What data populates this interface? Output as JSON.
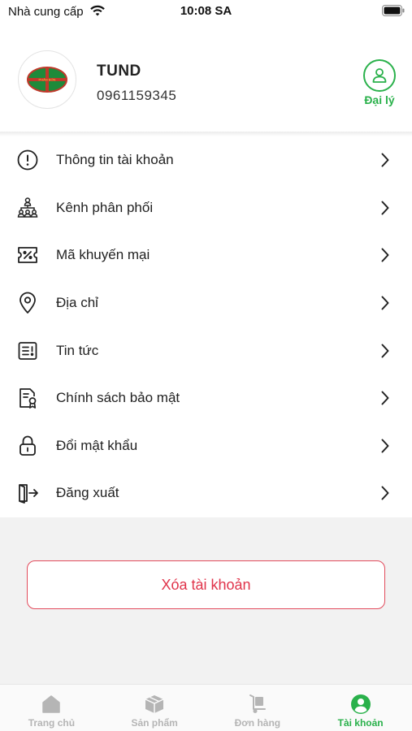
{
  "status_bar": {
    "carrier": "Nhà cung cấp",
    "time": "10:08 SA"
  },
  "profile": {
    "name": "TUND",
    "phone": "0961159345",
    "badge_label": "Đại lý",
    "logo_text": "PHÂN BÓN"
  },
  "menu": [
    {
      "label": "Thông tin tài khoản",
      "icon": "info-icon"
    },
    {
      "label": "Kênh phân phối",
      "icon": "distribution-icon"
    },
    {
      "label": "Mã khuyến mại",
      "icon": "coupon-icon"
    },
    {
      "label": "Địa chỉ",
      "icon": "location-pin-icon"
    },
    {
      "label": "Tin tức",
      "icon": "news-icon"
    },
    {
      "label": "Chính sách bảo mật",
      "icon": "privacy-policy-icon"
    },
    {
      "label": "Đổi mật khẩu",
      "icon": "lock-icon"
    },
    {
      "label": "Đăng xuất",
      "icon": "logout-icon"
    }
  ],
  "delete_account": {
    "label": "Xóa tài khoản"
  },
  "tabs": [
    {
      "label": "Trang chủ",
      "icon": "home-icon",
      "active": false
    },
    {
      "label": "Sản phẩm",
      "icon": "product-box-icon",
      "active": false
    },
    {
      "label": "Đơn hàng",
      "icon": "hand-truck-icon",
      "active": false
    },
    {
      "label": "Tài khoản",
      "icon": "account-icon",
      "active": true
    }
  ],
  "colors": {
    "accent": "#2ab14b",
    "danger": "#e0344b",
    "inactive": "#b5b5b5"
  }
}
